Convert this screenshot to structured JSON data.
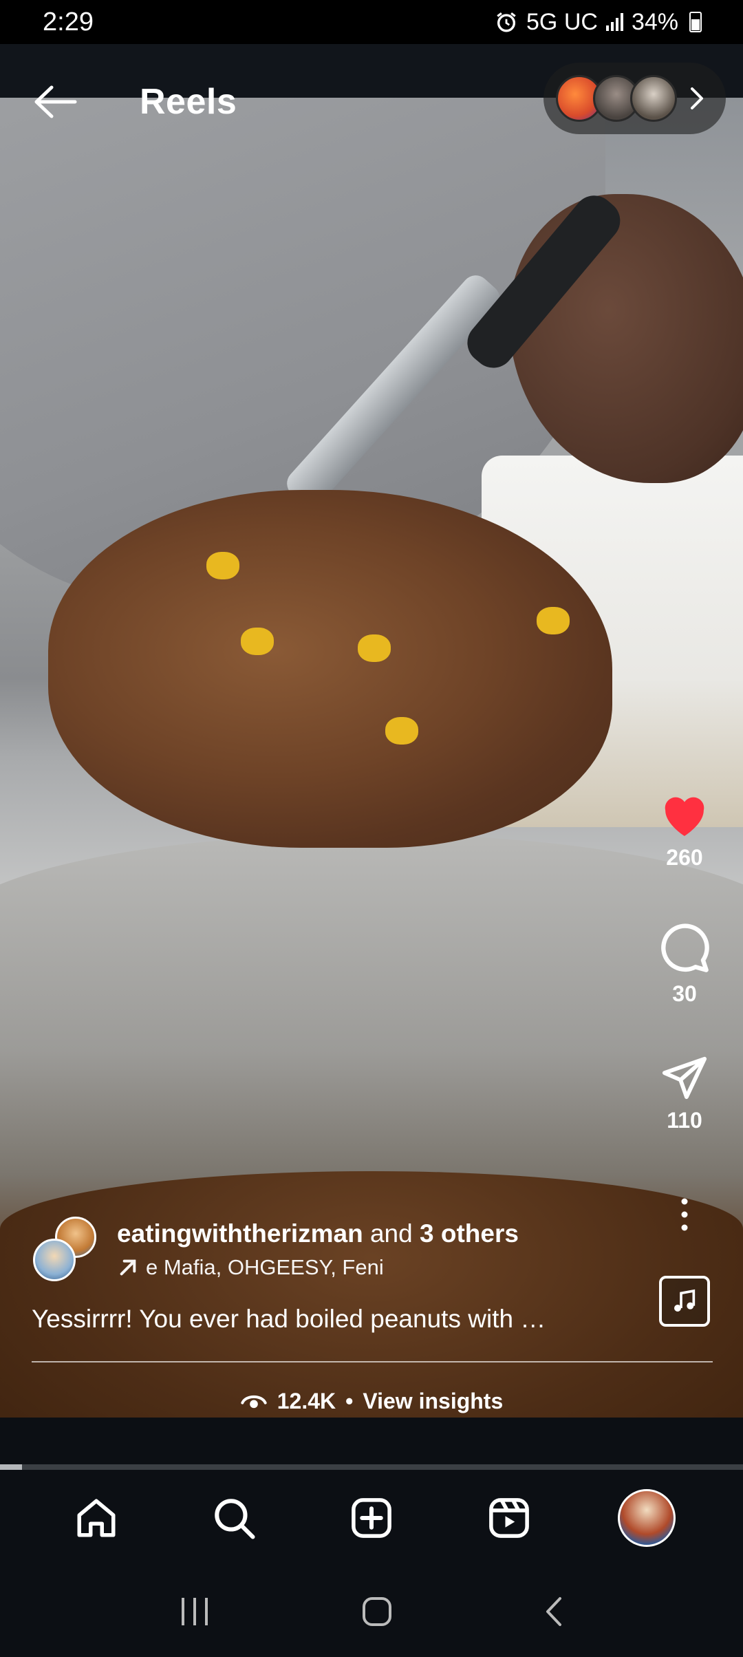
{
  "status": {
    "time": "2:29",
    "network": "5G UC",
    "battery": "34%"
  },
  "header": {
    "title": "Reels"
  },
  "actions": {
    "likes": "260",
    "comments": "30",
    "shares": "110"
  },
  "author": {
    "name": "eatingwiththerizman",
    "and_text": "and",
    "others": "3 others",
    "collab_text": "e Mafia, OHGEESY, Feni"
  },
  "caption": "Yessirrrr! You ever had boiled peanuts with …",
  "insights": {
    "views": "12.4K",
    "separator": "•",
    "label": "View insights"
  },
  "video": {
    "progress": 0.03
  },
  "colors": {
    "like": "#ff3040",
    "background": "#0c0f14"
  }
}
